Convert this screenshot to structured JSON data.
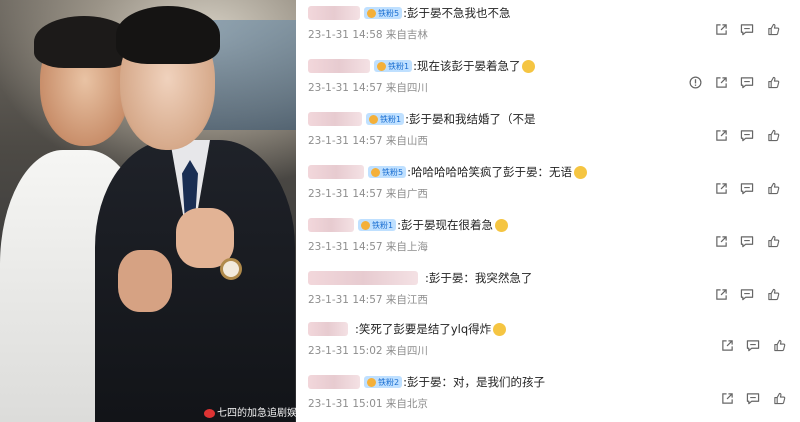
{
  "watermark": "七四的加急追剧娱",
  "comments": [
    {
      "badge": "铁粉5",
      "text": ":彭于晏不急我也不急",
      "time": "23-1-31 14:58",
      "loc": "来自吉林",
      "emoji": false,
      "report": false
    },
    {
      "badge": "铁粉1",
      "text": ":现在该彭于晏着急了",
      "time": "23-1-31 14:57",
      "loc": "来自四川",
      "emoji": true,
      "report": true
    },
    {
      "badge": "铁粉1",
      "text": ":彭于晏和我结婚了（不是",
      "time": "23-1-31 14:57",
      "loc": "来自山西",
      "emoji": false,
      "report": false
    },
    {
      "badge": "铁粉5",
      "text": ":哈哈哈哈哈笑疯了彭于晏：无语",
      "time": "23-1-31 14:57",
      "loc": "来自广西",
      "emoji": true,
      "report": false
    },
    {
      "badge": "铁粉1",
      "text": ":彭于晏现在很着急",
      "time": "23-1-31 14:57",
      "loc": "来自上海",
      "emoji": true,
      "report": false
    },
    {
      "badge": "",
      "text": ":彭于晏：我突然急了",
      "time": "23-1-31 14:57",
      "loc": "来自江西",
      "emoji": false,
      "report": false
    },
    {
      "badge": "",
      "text": ":笑死了彭要是结了ylq得炸",
      "time": "23-1-31 15:02",
      "loc": "来自四川",
      "emoji": true,
      "report": false
    },
    {
      "badge": "铁粉2",
      "text": ":彭于晏：对，是我们的孩子",
      "time": "23-1-31 15:01",
      "loc": "来自北京",
      "emoji": false,
      "report": false
    }
  ]
}
